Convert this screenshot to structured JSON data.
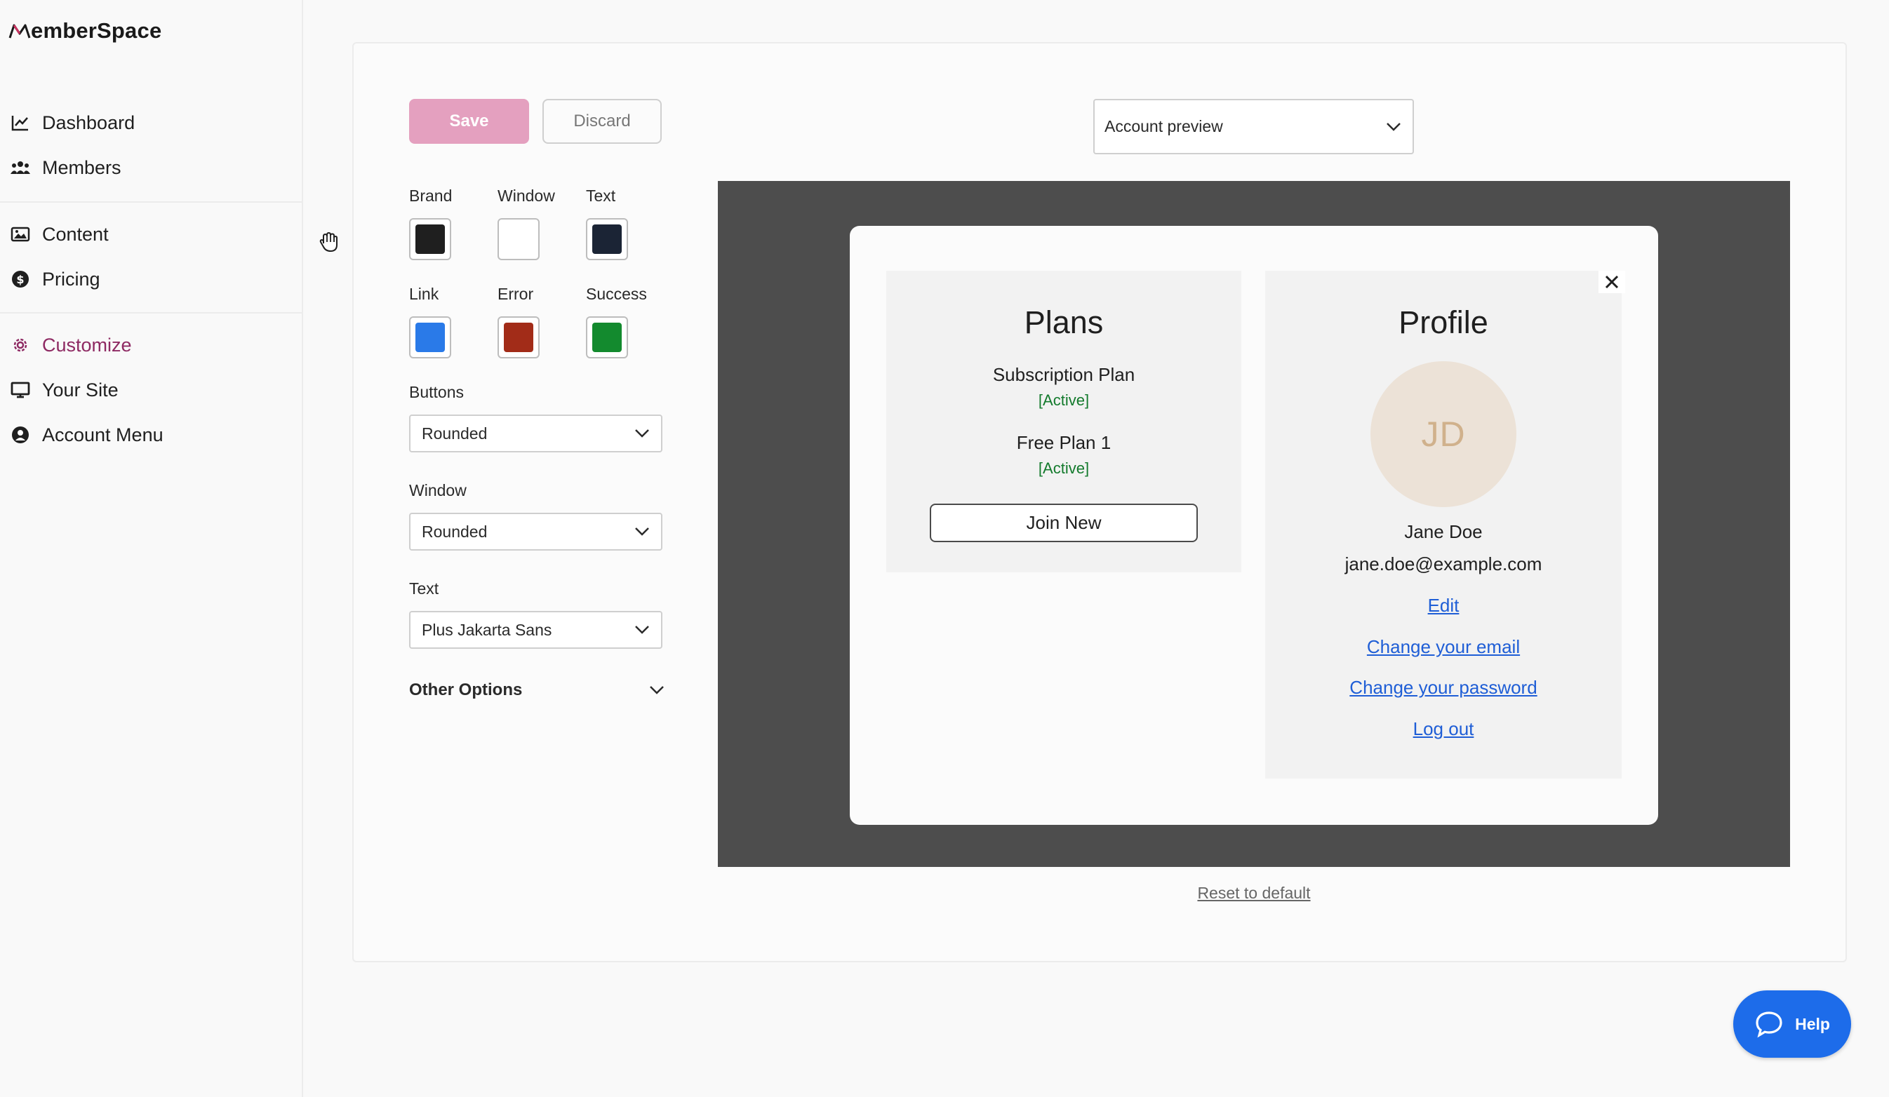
{
  "app": {
    "brand": "emberSpace"
  },
  "sidebar": {
    "groups": [
      [
        {
          "label": "Dashboard",
          "icon": "chart-line-icon"
        },
        {
          "label": "Members",
          "icon": "users-icon"
        }
      ],
      [
        {
          "label": "Content",
          "icon": "image-icon"
        },
        {
          "label": "Pricing",
          "icon": "dollar-circle-icon"
        }
      ],
      [
        {
          "label": "Customize",
          "icon": "gear-icon",
          "active": true
        },
        {
          "label": "Your Site",
          "icon": "monitor-icon"
        },
        {
          "label": "Account Menu",
          "icon": "user-circle-icon"
        }
      ]
    ],
    "active_color": "#8e2a63"
  },
  "toolbar": {
    "save_label": "Save",
    "discard_label": "Discard"
  },
  "colors": {
    "brand_label": "Brand",
    "brand_value": "#1f1f1f",
    "window_label": "Window",
    "window_value": "#ffffff",
    "text_label": "Text",
    "text_value": "#1b2435",
    "link_label": "Link",
    "link_value": "#2a7ae8",
    "error_label": "Error",
    "error_value": "#a22c18",
    "success_label": "Success",
    "success_value": "#138a2e"
  },
  "settings": {
    "buttons_label": "Buttons",
    "buttons_value": "Rounded",
    "window_label": "Window",
    "window_value": "Rounded",
    "text_label": "Text",
    "text_value": "Plus Jakarta Sans",
    "other_options_label": "Other Options"
  },
  "preview": {
    "selector_value": "Account preview",
    "plans": {
      "title": "Plans",
      "items": [
        {
          "name": "Subscription Plan",
          "status": "[Active]"
        },
        {
          "name": "Free Plan 1",
          "status": "[Active]"
        }
      ],
      "join_label": "Join New"
    },
    "profile": {
      "title": "Profile",
      "initials": "JD",
      "name": "Jane Doe",
      "email": "jane.doe@example.com",
      "links": [
        "Edit",
        "Change your email",
        "Change your password",
        "Log out"
      ]
    },
    "reset_label": "Reset to default"
  },
  "help": {
    "label": "Help"
  }
}
